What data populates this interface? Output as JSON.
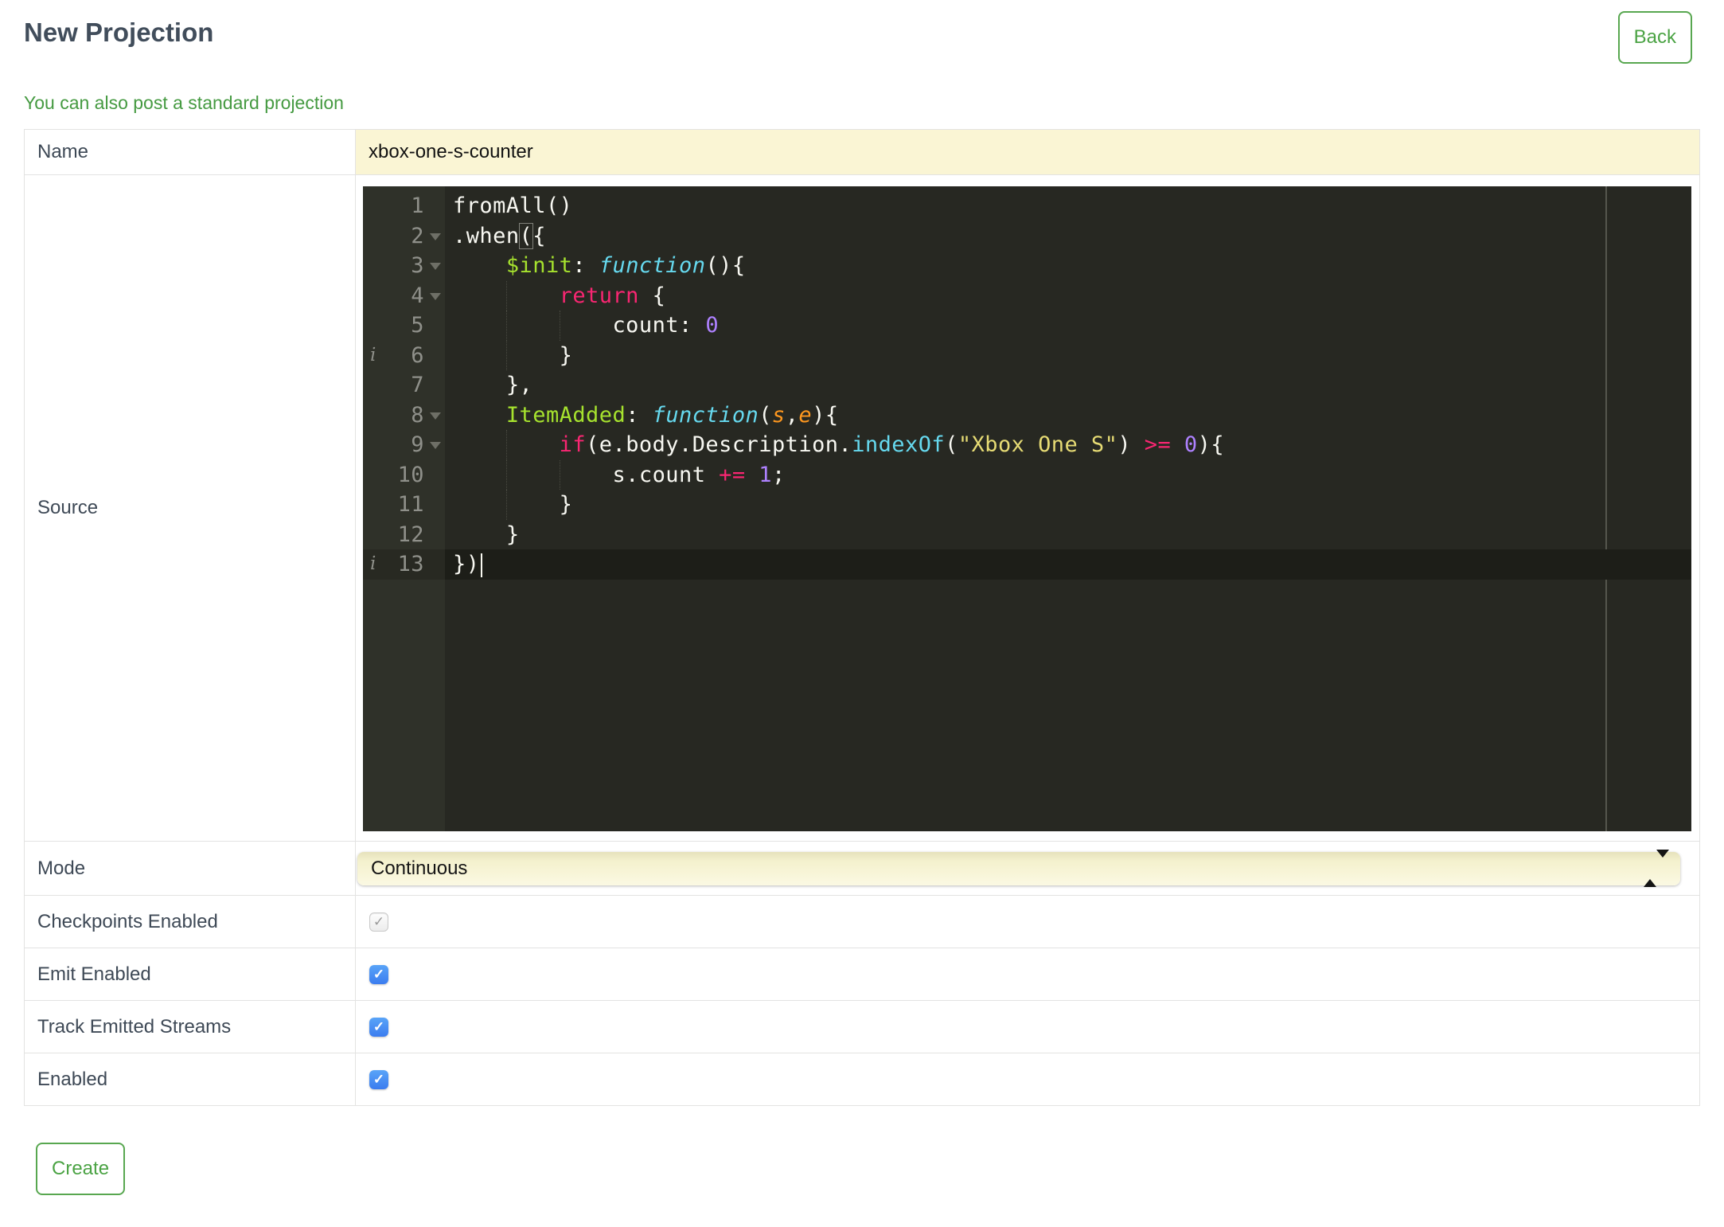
{
  "page": {
    "title": "New Projection",
    "back_label": "Back",
    "link_text": "You can also post a standard projection",
    "create_label": "Create"
  },
  "form": {
    "name": {
      "label": "Name",
      "value": "xbox-one-s-counter"
    },
    "source": {
      "label": "Source"
    },
    "mode": {
      "label": "Mode",
      "value": "Continuous"
    },
    "checkpoints": {
      "label": "Checkpoints Enabled",
      "checked": true,
      "disabled": true
    },
    "emit": {
      "label": "Emit Enabled",
      "checked": true,
      "disabled": false
    },
    "track": {
      "label": "Track Emitted Streams",
      "checked": true,
      "disabled": false
    },
    "enabled": {
      "label": "Enabled",
      "checked": true,
      "disabled": false
    }
  },
  "colors": {
    "accent_green": "#4BA344",
    "title_text": "#414D5B",
    "checkbox_blue": "#3F82F1",
    "input_yellow": "#FAF5D4",
    "editor_background": "#272822",
    "editor_gutter": "#2F3129",
    "editor_active_line": "#1D1E18",
    "token_keyword": "#F92672",
    "token_function_name": "#A6E22E",
    "token_storage": "#66D9EF",
    "token_string": "#E6DB74",
    "token_number": "#AE81FF",
    "token_parameter": "#FD971F",
    "token_text": "#F8F8F2"
  },
  "source_editor": {
    "check_glyph": "✓",
    "annotations": [
      6,
      13
    ],
    "fold_lines": [
      2,
      3,
      4,
      8,
      9
    ],
    "active_line": 13,
    "lines": [
      {
        "num": 1,
        "tokens": [
          [
            "fromAll()",
            "text"
          ]
        ]
      },
      {
        "num": 2,
        "tokens": [
          [
            ".when",
            "text"
          ],
          [
            "(",
            "paren-match"
          ],
          [
            "{",
            "text"
          ]
        ]
      },
      {
        "num": 3,
        "tokens": [
          [
            "    ",
            "text"
          ],
          [
            "$init",
            "function-name"
          ],
          [
            ": ",
            "text"
          ],
          [
            "function",
            "storage"
          ],
          [
            "(){",
            "text"
          ]
        ]
      },
      {
        "num": 4,
        "tokens": [
          [
            "        ",
            "text"
          ],
          [
            "return",
            "keyword"
          ],
          [
            " {",
            "text"
          ]
        ]
      },
      {
        "num": 5,
        "tokens": [
          [
            "            count: ",
            "text"
          ],
          [
            "0",
            "number"
          ]
        ]
      },
      {
        "num": 6,
        "tokens": [
          [
            "        }",
            "text"
          ]
        ]
      },
      {
        "num": 7,
        "tokens": [
          [
            "    },",
            "text"
          ]
        ]
      },
      {
        "num": 8,
        "tokens": [
          [
            "    ",
            "text"
          ],
          [
            "ItemAdded",
            "function-name"
          ],
          [
            ": ",
            "text"
          ],
          [
            "function",
            "storage"
          ],
          [
            "(",
            "text"
          ],
          [
            "s",
            "parameter"
          ],
          [
            ",",
            "text"
          ],
          [
            "e",
            "parameter"
          ],
          [
            "){",
            "text"
          ]
        ]
      },
      {
        "num": 9,
        "tokens": [
          [
            "        ",
            "text"
          ],
          [
            "if",
            "keyword"
          ],
          [
            "(e.body.Description.",
            "text"
          ],
          [
            "indexOf",
            "support"
          ],
          [
            "(",
            "text"
          ],
          [
            "\"Xbox One S\"",
            "string"
          ],
          [
            ") ",
            "text"
          ],
          [
            ">=",
            "keyword"
          ],
          [
            " ",
            "text"
          ],
          [
            "0",
            "number"
          ],
          [
            "){",
            "text"
          ]
        ]
      },
      {
        "num": 10,
        "tokens": [
          [
            "            s.count ",
            "text"
          ],
          [
            "+=",
            "keyword"
          ],
          [
            " ",
            "text"
          ],
          [
            "1",
            "number"
          ],
          [
            ";",
            "text"
          ]
        ]
      },
      {
        "num": 11,
        "tokens": [
          [
            "        }",
            "text"
          ]
        ]
      },
      {
        "num": 12,
        "tokens": [
          [
            "    }",
            "text"
          ]
        ]
      },
      {
        "num": 13,
        "cursor": true,
        "tokens": [
          [
            "})",
            "text"
          ]
        ]
      }
    ]
  }
}
